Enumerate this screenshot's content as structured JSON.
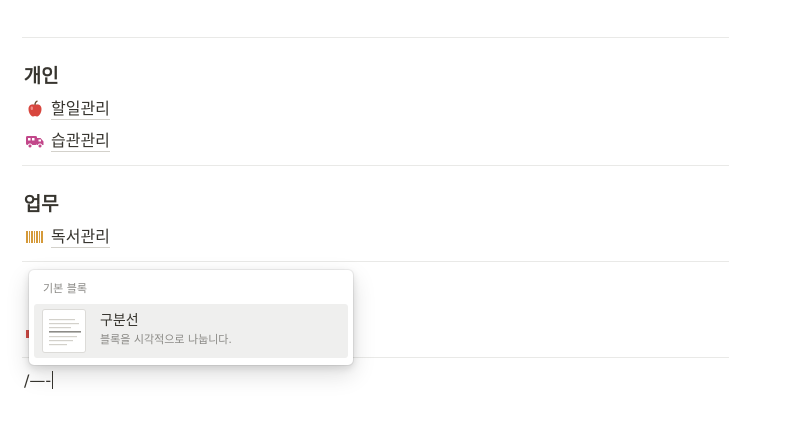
{
  "sections": [
    {
      "heading": "개인",
      "links": [
        {
          "label": "할일관리",
          "icon": "apple-icon"
        },
        {
          "label": "습관관리",
          "icon": "truck-icon"
        }
      ]
    },
    {
      "heading": "업무",
      "links": [
        {
          "label": "독서관리",
          "icon": "barcode-icon"
        }
      ]
    }
  ],
  "editor": {
    "current_text": "/—-"
  },
  "slash_menu": {
    "section_label": "기본 블록",
    "items": [
      {
        "title": "구분선",
        "description": "블록을 시각적으로 나눕니다."
      }
    ]
  },
  "colors": {
    "text": "#37352f",
    "divider": "#e9e9e7",
    "hover_bg": "#efefee",
    "muted": "#8c8b87"
  }
}
